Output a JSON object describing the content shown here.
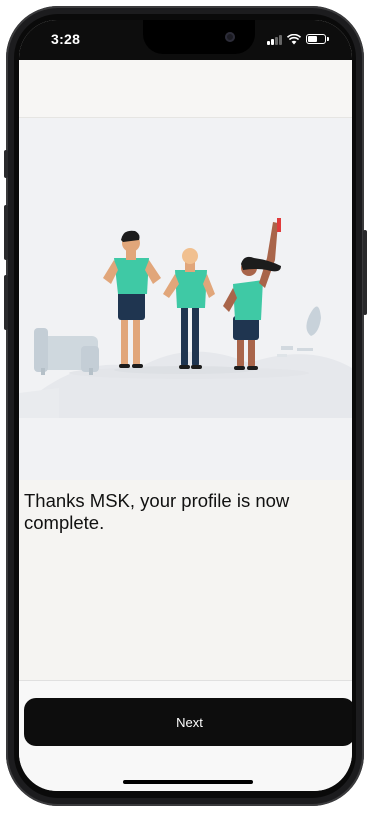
{
  "status_bar": {
    "time": "3:28",
    "icons": [
      "signal-icon",
      "wifi-icon",
      "battery-icon"
    ]
  },
  "illustration": {
    "description_icon": "three-people-illustration"
  },
  "content": {
    "message": "Thanks MSK, your profile is now complete."
  },
  "footer": {
    "next_label": "Next"
  },
  "colors": {
    "accent": "#3fc9a5",
    "button": "#0d0d0d",
    "background": "#f4f3f1"
  }
}
